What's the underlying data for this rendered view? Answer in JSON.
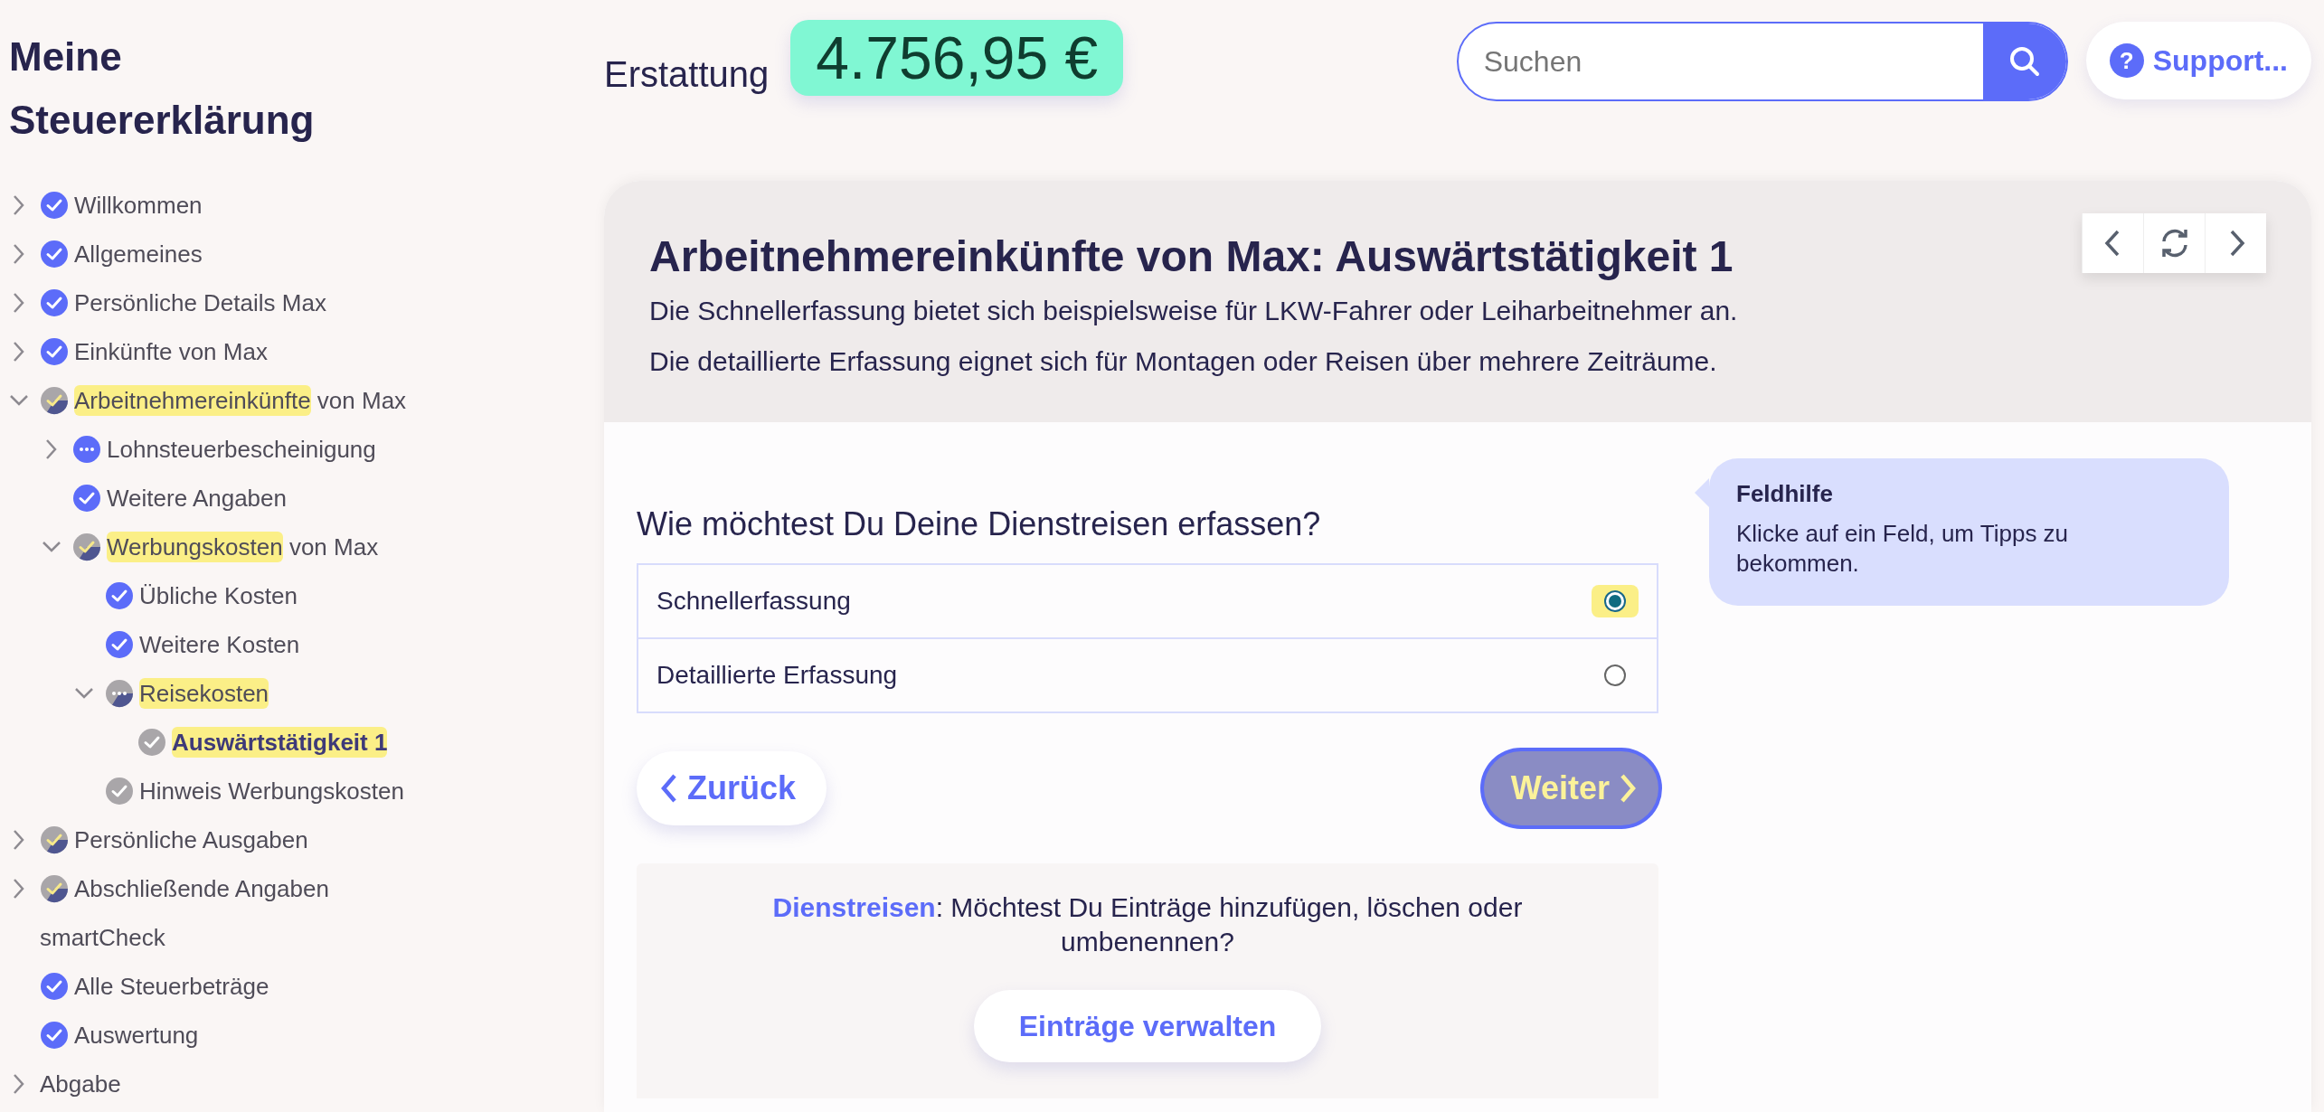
{
  "app_title": "Meine Steuererklärung",
  "refund": {
    "label": "Erstattung",
    "amount": "4.756,95 €"
  },
  "search": {
    "placeholder": "Suchen"
  },
  "support_button": {
    "icon_text": "?",
    "label": "Support..."
  },
  "sidebar": {
    "items": [
      {
        "label": "Willkommen",
        "kind": "done",
        "expanded": false,
        "selected": false
      },
      {
        "label": "Allgemeines",
        "kind": "done",
        "expanded": false,
        "selected": false
      },
      {
        "label": "Persönliche Details Max",
        "kind": "done",
        "expanded": false,
        "selected": false
      },
      {
        "label": "Einkünfte von Max",
        "kind": "done",
        "expanded": false,
        "selected": false
      },
      {
        "highlight": "Arbeitnehmereinkünfte",
        "label": "von Max",
        "kind": "partial",
        "expanded": true,
        "selected": false,
        "children": [
          {
            "label": "Lohnsteuerbescheinigung",
            "kind": "open",
            "expanded": false,
            "selected": false
          },
          {
            "label": "Weitere Angaben",
            "kind": "done",
            "selected": false
          },
          {
            "highlight": "Werbungskosten",
            "label": "von Max",
            "kind": "partial",
            "expanded": true,
            "selected": false,
            "children": [
              {
                "label": "Übliche Kosten",
                "kind": "done",
                "selected": false
              },
              {
                "label": "Weitere Kosten",
                "kind": "done",
                "selected": false
              },
              {
                "highlight": "Reisekosten",
                "kind": "openpartial",
                "expanded": true,
                "selected": false,
                "children": [
                  {
                    "highlight": "Auswärtstätigkeit 1",
                    "kind": "unvisited",
                    "selected": true
                  }
                ]
              },
              {
                "label": "Hinweis Werbungskosten",
                "kind": "unvisited",
                "selected": false
              }
            ]
          }
        ]
      },
      {
        "label": "Persönliche Ausgaben",
        "kind": "partial",
        "expanded": false,
        "selected": false
      },
      {
        "label": "Abschließende Angaben",
        "kind": "partial",
        "expanded": false,
        "selected": false
      },
      {
        "label": "smartCheck",
        "selected": false
      },
      {
        "label": "Alle Steuerbeträge",
        "kind": "done",
        "selected": false
      },
      {
        "label": "Auswertung",
        "kind": "done",
        "selected": false
      },
      {
        "label": "Abgabe",
        "expanded": false,
        "selected": false
      }
    ]
  },
  "page": {
    "title": "Arbeitnehmereinkünfte von Max: Auswärtstätigkeit 1",
    "descriptions": [
      "Die Schnellerfassung bietet sich beispielsweise für LKW-Fahrer oder Leiharbeitnehmer an.",
      "Die detaillierte Erfassung eignet sich für Montagen oder Reisen über mehrere Zeiträume."
    ],
    "question": "Wie möchtest Du Deine Dienstreisen erfassen?",
    "options": [
      {
        "label": "Schnellerfassung",
        "selected": true,
        "highlighted": true
      },
      {
        "label": "Detaillierte Erfassung",
        "selected": false,
        "highlighted": false
      }
    ],
    "back_button": "Zurück",
    "next_button": {
      "label": "Weiter",
      "highlighted": true
    },
    "entries_panel": {
      "text": "**Dienstreisen**: Möchtest Du Einträge hinzufügen, löschen oder umbenennen?",
      "button": "Einträge verwalten"
    },
    "field_help": {
      "title": "Feldhilfe",
      "text": "Klicke auf ein Feld, um Tipps zu bekommen."
    }
  }
}
